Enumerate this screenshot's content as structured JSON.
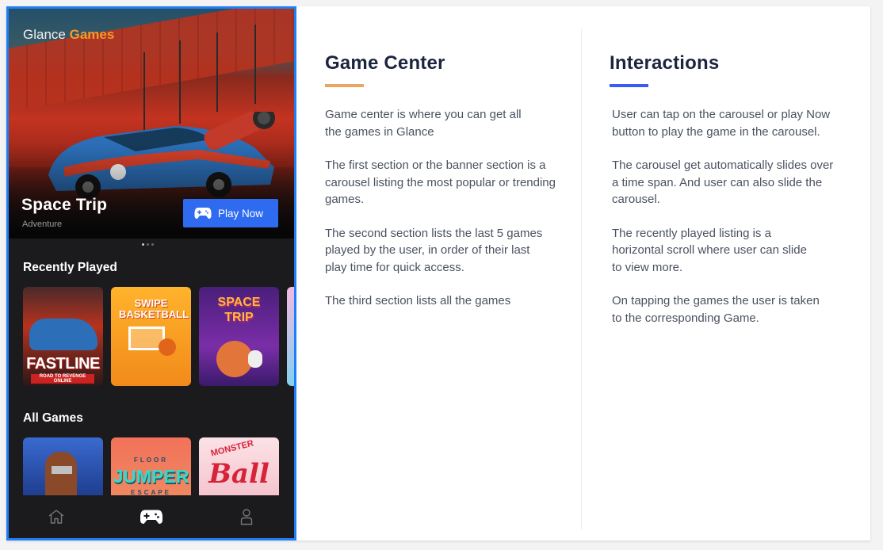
{
  "phone": {
    "brand": {
      "prefix": "Glance",
      "accent": "Games"
    },
    "banner": {
      "title": "Space Trip",
      "subtitle": "Adventure",
      "play_label": "Play Now",
      "dots": 3,
      "active_dot": 0
    },
    "recently_played": {
      "title": "Recently Played",
      "games": [
        {
          "name": "FASTLINE",
          "tagline": "ROAD TO REVENGE ONLINE"
        },
        {
          "name": "SWIPE BASKETBALL"
        },
        {
          "name": "SPACE TRIP"
        }
      ]
    },
    "all_games": {
      "title": "All Games",
      "games": [
        {
          "name": ""
        },
        {
          "name": "FLOOR JUMPER ESCAPE",
          "line1": "FLOOR",
          "line2": "JUMPER",
          "line3": "ESCAPE"
        },
        {
          "name": "MONSTER Ball",
          "line1": "MONSTER",
          "line2": "Ball"
        }
      ]
    },
    "tabs": [
      "home-icon",
      "gamepad-icon",
      "profile-icon"
    ],
    "active_tab": 1
  },
  "colors": {
    "accent_orange": "#f39a2b",
    "primary_blue": "#2f6bf0",
    "frame_blue": "#1f7ef5",
    "heading": "#1c2540",
    "body_text": "#4a5260",
    "underline_orange": "#e8a564",
    "underline_blue": "#3b5bf5"
  },
  "game_center": {
    "heading": "Game Center",
    "paragraphs": [
      "Game center is where you can get all the games in Glance",
      "The first section or the banner section is a carousel listing the most popular or trending games.",
      "The second section lists the last 5 games played by the user, in order of their last play time for quick access.",
      "The third section lists all the games"
    ]
  },
  "interactions": {
    "heading": "Interactions",
    "paragraphs": [
      "User can tap on the carousel or play Now button to play the game in the carousel.",
      "The carousel get automatically slides over a time span. And user can also slide the carousel.",
      "The recently played listing is a horizontal scroll where user can slide to view more.",
      "On tapping the games the user is taken to the corresponding Game."
    ]
  }
}
